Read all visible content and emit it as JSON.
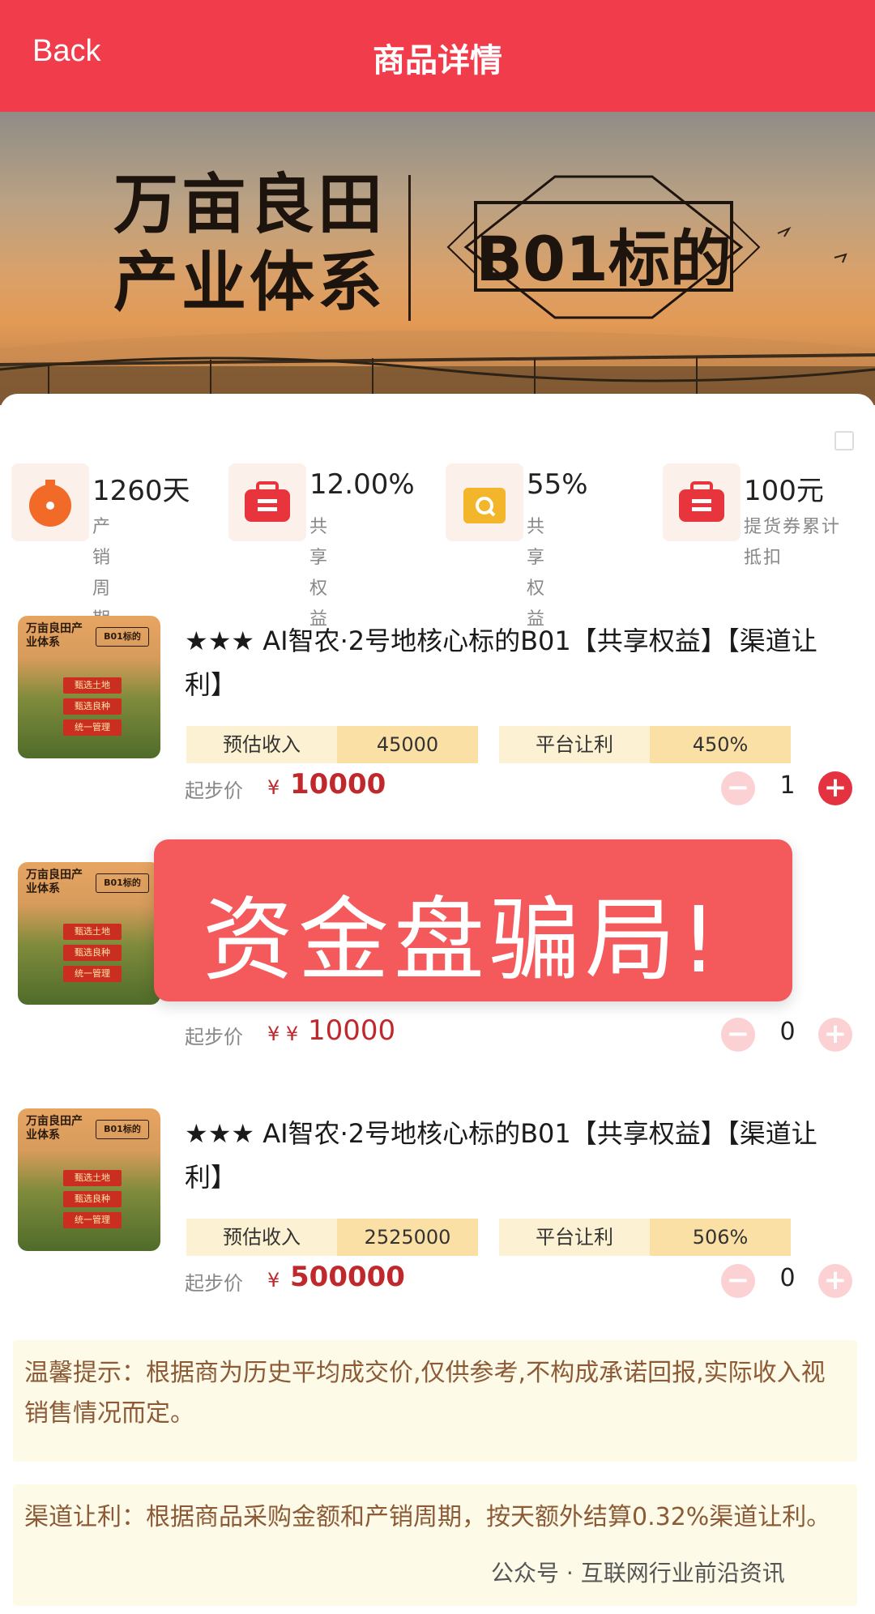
{
  "header": {
    "back_label": "Back",
    "title": "商品详情"
  },
  "banner": {
    "title_line1": "万亩良田",
    "title_line2": "产业体系",
    "badge": "B01标的"
  },
  "stats": [
    {
      "icon": "timer-icon",
      "value": "1260天",
      "label": "产销周期"
    },
    {
      "icon": "briefcase-icon",
      "value": "12.00%",
      "label": "共享权益"
    },
    {
      "icon": "wallet-icon",
      "value": "55%",
      "label": "共享权益"
    },
    {
      "icon": "briefcase-icon",
      "value": "100元",
      "label": "提货券累计抵扣"
    }
  ],
  "thumbnail": {
    "title": "万亩良田产业体系",
    "badge": "B01标的",
    "tags": [
      "甄选土地",
      "甄选良种",
      "统一管理"
    ]
  },
  "products": [
    {
      "name": "★★★ AI智农·2号地核心标的B01【共享权益】【渠道让利】",
      "income_label": "预估收入",
      "income_value": "45000",
      "profit_label": "平台让利",
      "profit_value": "450%",
      "price_label": "起步价",
      "price_currency": "¥",
      "price_value": "10000",
      "quantity": "1"
    },
    {
      "name": "",
      "income_label": "",
      "income_value": "",
      "profit_label": "",
      "profit_value": "",
      "price_label": "起步价",
      "price_currency": "¥ ¥",
      "price_value": "10000",
      "quantity": "0"
    },
    {
      "name": "★★★ AI智农·2号地核心标的B01【共享权益】【渠道让利】",
      "income_label": "预估收入",
      "income_value": "2525000",
      "profit_label": "平台让利",
      "profit_value": "506%",
      "price_label": "起步价",
      "price_currency": "¥",
      "price_value": "500000",
      "quantity": "0"
    }
  ],
  "overlay": {
    "text": "资金盘骗局!"
  },
  "notes": {
    "tip": "温馨提示：根据商为历史平均成交价,仅供参考,不构成承诺回报,实际收入视销售情况而定。",
    "channel": "渠道让利：根据商品采购金额和产销周期，按天额外结算0.32%渠道让利。"
  },
  "footer": {
    "brand": "公众号 · 互联网行业前沿资讯"
  },
  "colors": {
    "header": "#f03c4b",
    "accent": "#e53240",
    "price": "#c0282c",
    "note_text": "#8c5a36"
  }
}
